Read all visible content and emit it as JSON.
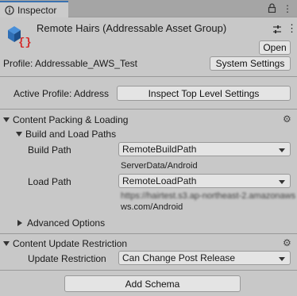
{
  "tab": {
    "icon": "info-icon",
    "title": "Inspector",
    "icons": [
      "lock-icon",
      "more-menu-icon"
    ]
  },
  "header": {
    "title": "Remote Hairs (Addressable Asset Group)",
    "icon": "addressable-group-icon",
    "settings_icon": "sliders-icon",
    "more_icon": "more-menu-icon",
    "open_button": "Open"
  },
  "profile": {
    "label": "Profile: Addressable_AWS_Test",
    "system_settings_button": "System Settings"
  },
  "active_profile": {
    "label": "Active Profile: Address",
    "inspect_button": "Inspect Top Level Settings"
  },
  "content_packing": {
    "title": "Content Packing & Loading",
    "build_load_paths_title": "Build and Load Paths",
    "build_path_label": "Build Path",
    "build_path_value": "RemoteBuildPath",
    "build_path_resolved": "ServerData/Android",
    "load_path_label": "Load Path",
    "load_path_value": "RemoteLoadPath",
    "load_path_resolved_line1": "https://hairtest.s3.ap-northeast-2.amazonaws",
    "load_path_resolved_line2": "ws.com/Android",
    "advanced_options": "Advanced Options"
  },
  "update_restriction": {
    "title": "Content Update Restriction",
    "label": "Update Restriction",
    "value": "Can Change Post Release"
  },
  "add_schema_button": "Add Schema"
}
